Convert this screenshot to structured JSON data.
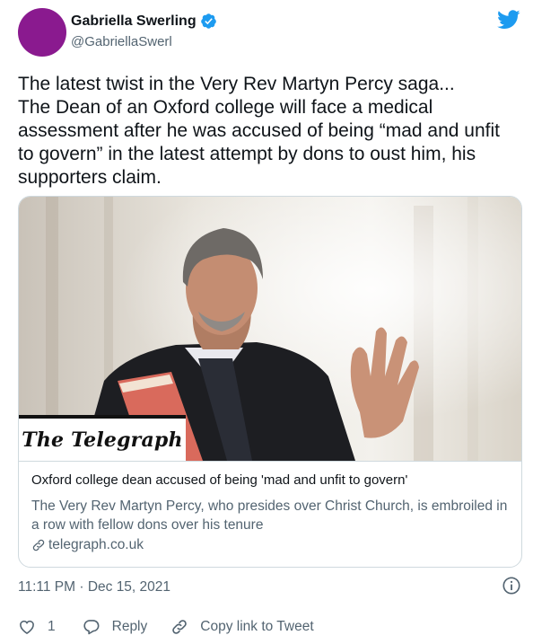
{
  "author": {
    "name": "Gabriella Swerling",
    "handle": "@GabriellaSwerl",
    "avatar_color": "#8a1a8f",
    "verified": true
  },
  "tweet": {
    "text_line1": "The latest twist in the Very Rev Martyn Percy saga...",
    "text_line2": "The Dean of an Oxford college will face a medical assessment after he was accused of being “mad and unfit to govern” in the latest attempt by dons to oust him, his supporters claim."
  },
  "card": {
    "logo_text": "The Telegraph",
    "title": "Oxford college dean accused of being 'mad and unfit to govern'",
    "description": "The Very Rev Martyn Percy, who presides over Christ Church, is embroiled in a row with fellow dons over his tenure",
    "domain": "telegraph.co.uk"
  },
  "meta": {
    "timestamp": "11:11 PM · Dec 15, 2021"
  },
  "actions": {
    "like_count": "1",
    "reply_label": "Reply",
    "copy_label": "Copy link to Tweet"
  },
  "colors": {
    "twitter_blue": "#1d9bf0",
    "secondary_text": "#536471",
    "border": "#cfd9de"
  },
  "icons": [
    "verified-badge-icon",
    "twitter-bird-icon",
    "link-icon",
    "info-icon",
    "heart-icon",
    "reply-icon",
    "copy-link-icon"
  ]
}
